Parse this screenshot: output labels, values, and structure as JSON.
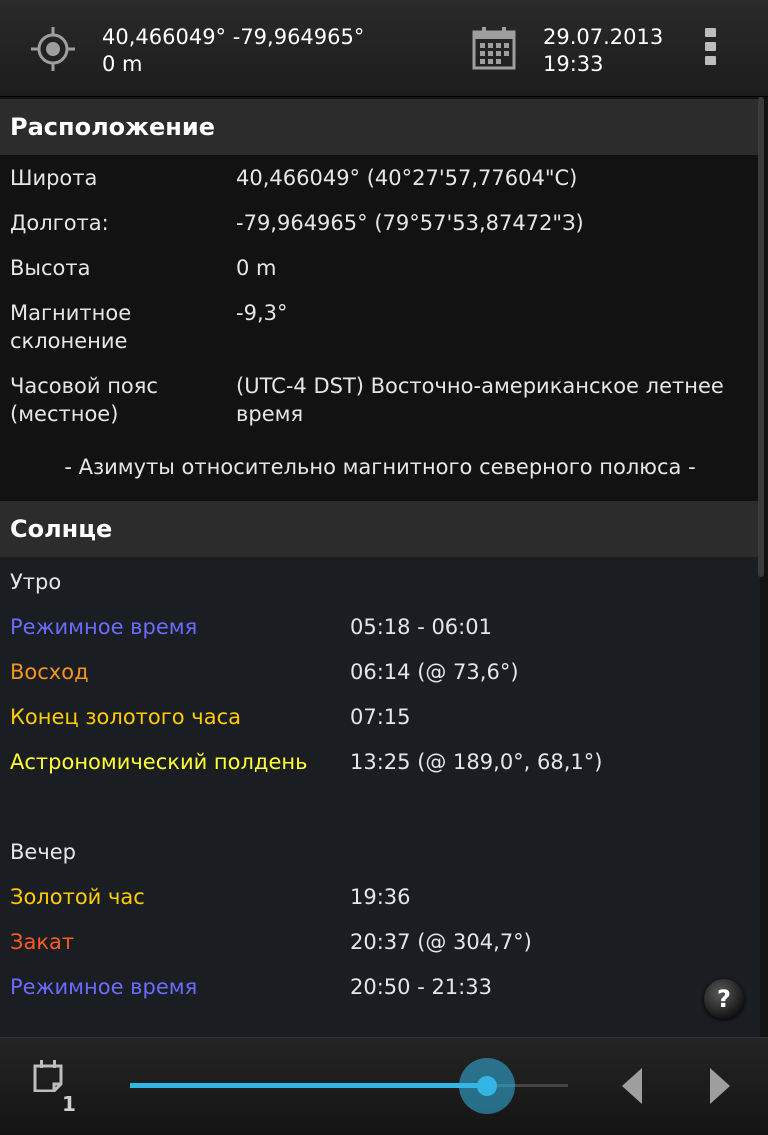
{
  "header": {
    "coordinates": "40,466049° -79,964965°",
    "altitude": "0 m",
    "date": "29.07.2013",
    "time": "19:33"
  },
  "location": {
    "title": "Расположение",
    "rows": [
      {
        "label": "Широта",
        "value": "40,466049° (40°27'57,77604\"С)"
      },
      {
        "label": "Долгота:",
        "value": "-79,964965° (79°57'53,87472\"З)"
      },
      {
        "label": "Высота",
        "value": "0 m"
      },
      {
        "label": "Магнитное\nсклонение",
        "value": "-9,3°"
      },
      {
        "label": "Часовой пояс\n(местное)",
        "value": "(UTC-4 DST) Восточно-американское летнее\nвремя"
      }
    ],
    "note": "- Азимуты относительно магнитного северного полюса -"
  },
  "sun": {
    "title": "Солнце",
    "morning_label": "Утро",
    "morning": [
      {
        "label": "Режимное время",
        "value": "05:18 - 06:01",
        "color": "#6b6bff"
      },
      {
        "label": "Восход",
        "value": "06:14 (@ 73,6°)",
        "color": "#f7941d"
      },
      {
        "label": "Конец золотого часа",
        "value": "07:15",
        "color": "#ffcc00"
      },
      {
        "label": "Астрономический полдень",
        "value": "13:25 (@ 189,0°, 68,1°)",
        "color": "#ffff33"
      }
    ],
    "evening_label": "Вечер",
    "evening": [
      {
        "label": "Золотой час",
        "value": "19:36",
        "color": "#ffcc00"
      },
      {
        "label": "Закат",
        "value": "20:37 (@ 304,7°)",
        "color": "#ff5a1f"
      },
      {
        "label": "Режимное время",
        "value": "20:50 - 21:33",
        "color": "#6b6bff"
      }
    ]
  },
  "help_label": "?",
  "bottom": {
    "day_count": "1",
    "time_slider_fraction": 0.814
  },
  "icons": {
    "gps": "gps-crosshair-icon",
    "calendar": "calendar-icon",
    "overflow": "overflow-menu-icon",
    "day": "day-page-icon",
    "prev": "chevron-left-icon",
    "next": "chevron-right-icon"
  }
}
